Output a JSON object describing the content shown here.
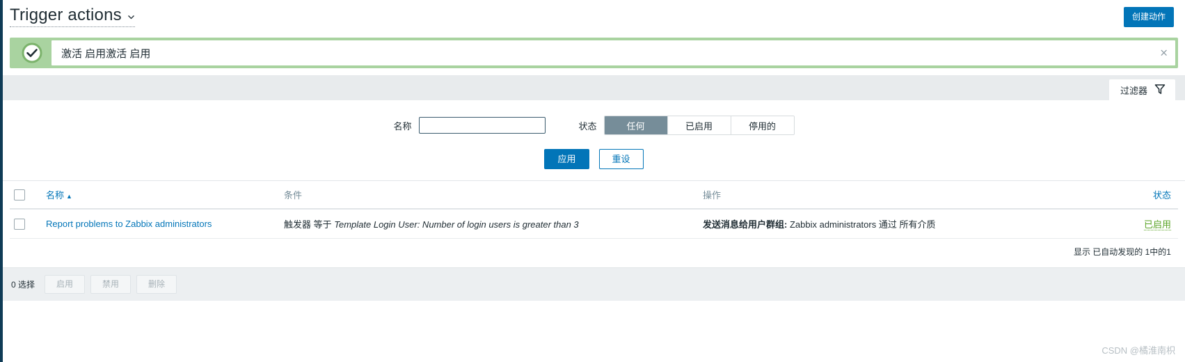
{
  "header": {
    "title": "Trigger actions",
    "title_chevron_icon": "chevron-down-icon",
    "create_button": "创建动作"
  },
  "message": {
    "icon": "check-circle-icon",
    "text": "激活 启用激活 启用",
    "close_icon": "×",
    "accent_color": "#a9d3a0"
  },
  "filter": {
    "tab_label": "过滤器",
    "tab_icon": "funnel-icon",
    "name_label": "名称",
    "name_value": "",
    "name_placeholder": "",
    "status_label": "状态",
    "status_options": [
      "任何",
      "已启用",
      "停用的"
    ],
    "status_selected": "任何",
    "apply_label": "应用",
    "reset_label": "重设"
  },
  "table": {
    "columns": {
      "name": "名称",
      "condition": "条件",
      "operations": "操作",
      "status": "状态"
    },
    "sort_indicator": "▲",
    "rows": [
      {
        "name": "Report problems to Zabbix administrators",
        "condition_prefix": "触发器 等于 ",
        "condition_value": "Template Login User: Number of login users is greater than 3",
        "operation_prefix": "发送消息给用户群组:",
        "operation_value": " Zabbix administrators 通过 所有介质",
        "status": "已启用"
      }
    ],
    "summary": "显示 已自动发现的 1中的1"
  },
  "action_bar": {
    "selected_text": "0 选择",
    "enable_label": "启用",
    "disable_label": "禁用",
    "delete_label": "删除"
  },
  "watermark": "CSDN @橘淮南枳",
  "colors": {
    "accent_blue": "#0275b8",
    "status_green": "#59a325",
    "segment_active": "#768d99"
  }
}
